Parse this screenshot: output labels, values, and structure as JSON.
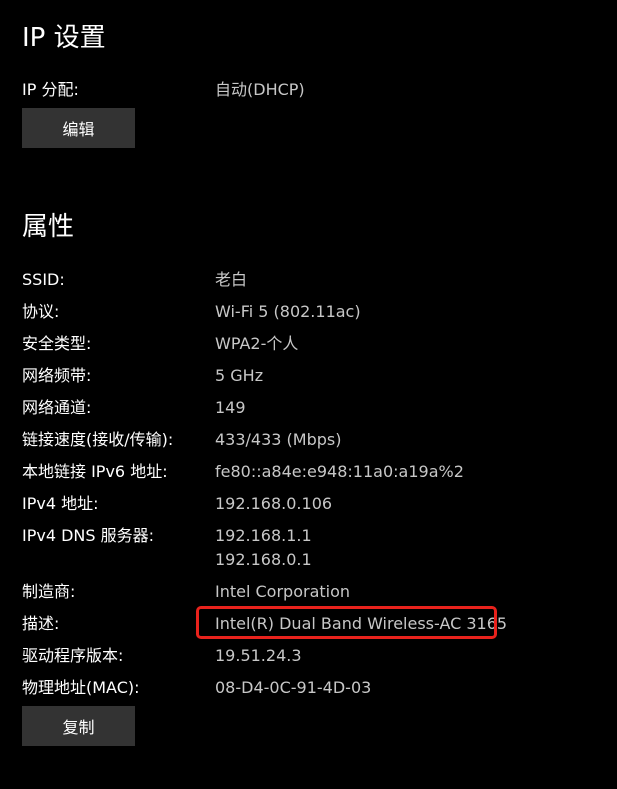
{
  "ip_settings": {
    "heading": "IP 设置",
    "assignment_label": "IP 分配:",
    "assignment_value": "自动(DHCP)",
    "edit_button": "编辑"
  },
  "properties": {
    "heading": "属性",
    "rows": [
      {
        "label": "SSID:",
        "value": "老白"
      },
      {
        "label": "协议:",
        "value": "Wi-Fi 5 (802.11ac)"
      },
      {
        "label": "安全类型:",
        "value": "WPA2-个人"
      },
      {
        "label": "网络频带:",
        "value": "5 GHz"
      },
      {
        "label": "网络通道:",
        "value": "149"
      },
      {
        "label": "链接速度(接收/传输):",
        "value": "433/433 (Mbps)"
      },
      {
        "label": "本地链接 IPv6 地址:",
        "value": "fe80::a84e:e948:11a0:a19a%2"
      },
      {
        "label": "IPv4 地址:",
        "value": "192.168.0.106"
      },
      {
        "label": "IPv4 DNS 服务器:",
        "values": [
          "192.168.1.1",
          "192.168.0.1"
        ]
      },
      {
        "label": "制造商:",
        "value": "Intel Corporation"
      },
      {
        "label": "描述:",
        "value": "Intel(R) Dual Band Wireless-AC 3165"
      },
      {
        "label": "驱动程序版本:",
        "value": "19.51.24.3"
      },
      {
        "label": "物理地址(MAC):",
        "value": "08-D4-0C-91-4D-03"
      }
    ],
    "copy_button": "复制"
  },
  "colors": {
    "background": "#000000",
    "label_text": "#ffffff",
    "value_text": "#c7c7c7",
    "button_bg": "#333333",
    "highlight_border": "#e8221c"
  }
}
